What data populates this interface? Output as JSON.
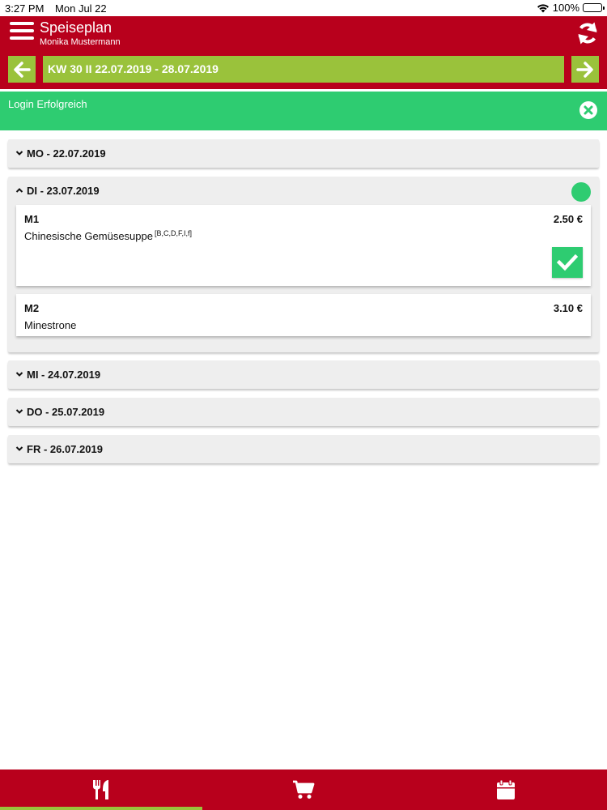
{
  "statusbar": {
    "time": "3:27 PM",
    "date": "Mon Jul 22",
    "battery": "100%"
  },
  "header": {
    "title": "Speiseplan",
    "user": "Monika Mustermann"
  },
  "week": {
    "label": "KW 30 II 22.07.2019 - 28.07.2019"
  },
  "banner": {
    "message": "Login Erfolgreich"
  },
  "days": [
    {
      "label": "MO - 22.07.2019",
      "expanded": false
    },
    {
      "label": "DI - 23.07.2019",
      "expanded": true,
      "meals": [
        {
          "code": "M1",
          "name": "Chinesische Gemüsesuppe",
          "allergens": "[B,C,D,F,I,f]",
          "price": "2.50 €",
          "selected": true
        },
        {
          "code": "M2",
          "name": "Minestrone",
          "allergens": "",
          "price": "3.10 €",
          "selected": false
        }
      ]
    },
    {
      "label": "MI - 24.07.2019",
      "expanded": false
    },
    {
      "label": "DO - 25.07.2019",
      "expanded": false
    },
    {
      "label": "FR - 26.07.2019",
      "expanded": false
    }
  ],
  "tabs": [
    {
      "icon": "cutlery-icon",
      "active": true
    },
    {
      "icon": "cart-icon",
      "active": false
    },
    {
      "icon": "calendar-icon",
      "active": false
    }
  ],
  "colors": {
    "primary": "#b8001c",
    "accent": "#9ac23b",
    "success": "#2ecc71",
    "day_bg": "#eeeeee"
  }
}
